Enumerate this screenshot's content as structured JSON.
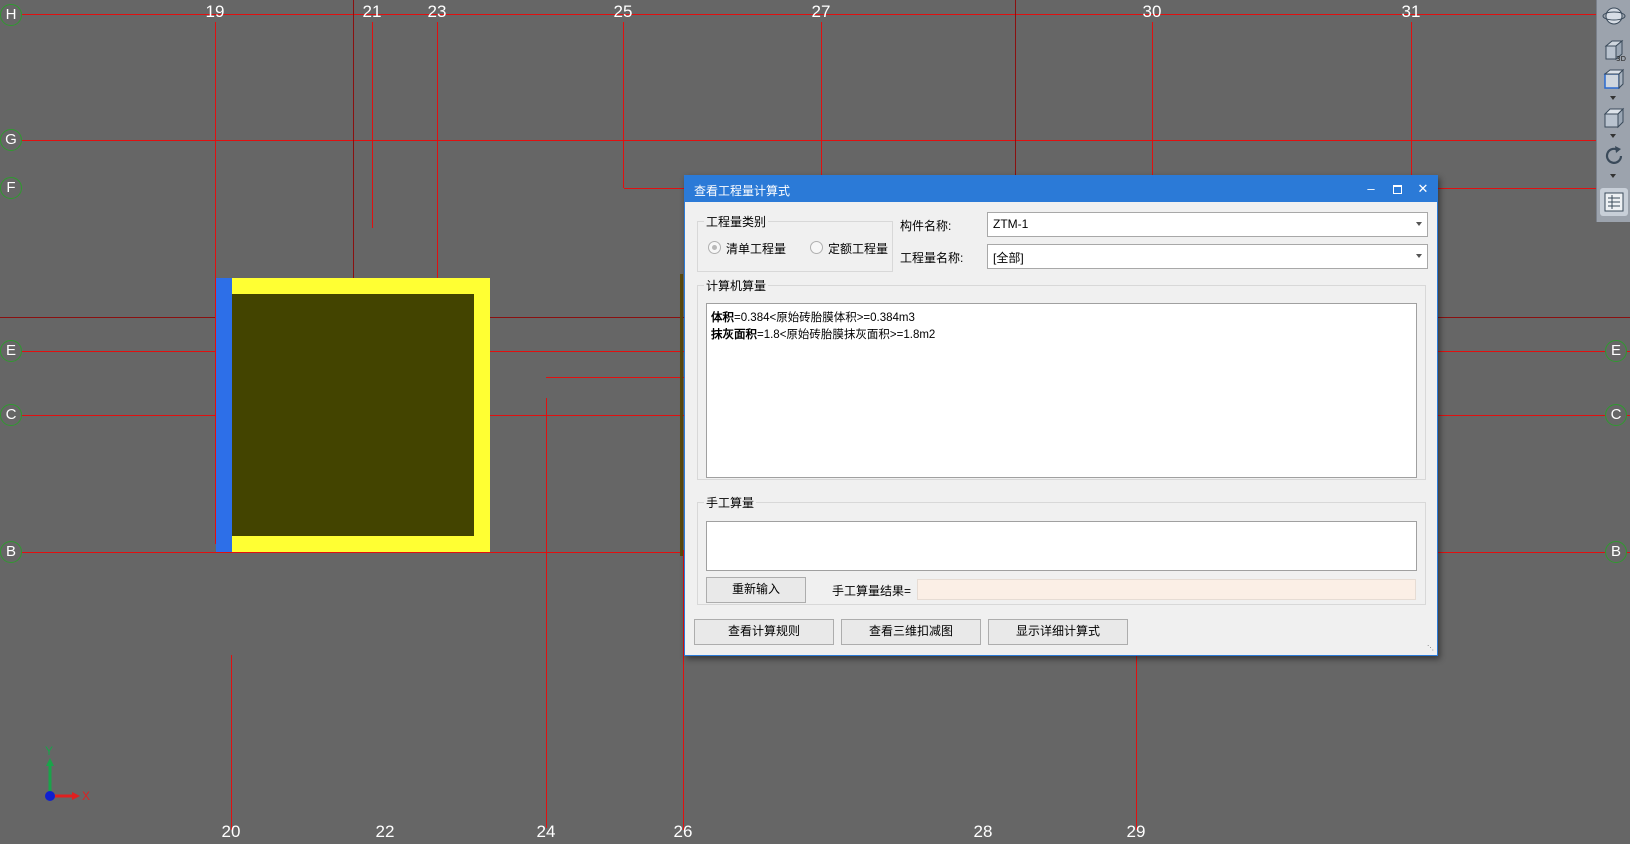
{
  "axes": {
    "top_labels": [
      "19",
      "21",
      "23",
      "25",
      "27",
      "30",
      "31"
    ],
    "bottom_labels": [
      "20",
      "22",
      "24",
      "26",
      "28",
      "29"
    ],
    "left_labels": [
      "H",
      "G",
      "F",
      "E",
      "C",
      "B"
    ],
    "right_labels": [
      "E",
      "C",
      "B"
    ]
  },
  "coord": {
    "y_label": "Y",
    "x_label": "X"
  },
  "toolbar": {
    "icons": [
      "orbit-icon",
      "view-3d-icon",
      "view-box-icon",
      "view-cube-icon",
      "rotate-icon",
      "properties-icon"
    ],
    "badge_3d": "3D"
  },
  "dialog": {
    "title": "查看工程量计算式",
    "quantity_type_group": "工程量类别",
    "radio_bill": "清单工程量",
    "radio_quota": "定额工程量",
    "component_label": "构件名称:",
    "component_value": "ZTM-1",
    "quantity_name_label": "工程量名称:",
    "quantity_name_value": "[全部]",
    "computer_group": "计算机算量",
    "formulas": [
      {
        "name": "体积",
        "expr": "=0.384<原始砖胎膜体积>=0.384m3"
      },
      {
        "name": "抹灰面积",
        "expr": "=1.8<原始砖胎膜抹灰面积>=1.8m2"
      }
    ],
    "manual_group": "手工算量",
    "reenter_button": "重新输入",
    "manual_result_label": "手工算量结果=",
    "manual_result_value": "",
    "btn_rules": "查看计算规则",
    "btn_3d_deduct": "查看三维扣减图",
    "btn_detail": "显示详细计算式"
  },
  "colors": {
    "background": "#666666",
    "axis_line": "#e01010",
    "title_bar": "#2b7ad7",
    "shape_fill": "#ffff33",
    "shape_inner": "#434400",
    "shape_edge": "#2d6fe8"
  }
}
